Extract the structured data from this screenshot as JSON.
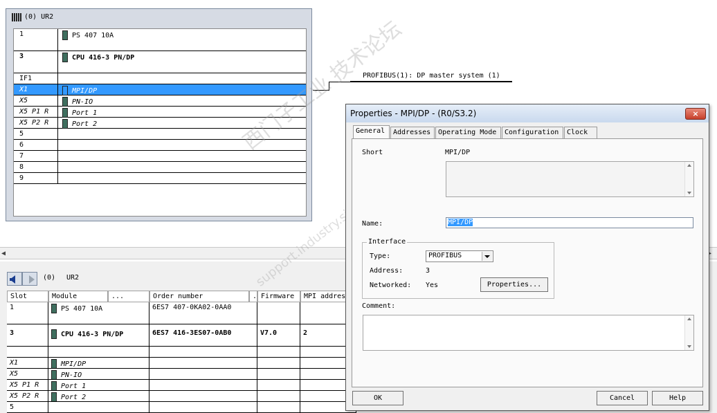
{
  "rack": {
    "title": "(0)  UR2",
    "rows": [
      {
        "slot": "1",
        "module": "PS 407 10A",
        "style": "normal",
        "icon": true
      },
      {
        "slot": "3",
        "module": "CPU 416-3 PN/DP",
        "style": "bold",
        "icon": true
      },
      {
        "slot": "IF1",
        "module": "",
        "style": "normal",
        "icon": false
      },
      {
        "slot": "X1",
        "module": "MPI/DP",
        "style": "italic",
        "icon": true,
        "selected": true
      },
      {
        "slot": "X5",
        "module": "PN-IO",
        "style": "italic",
        "icon": true
      },
      {
        "slot": "X5 P1 R",
        "module": "Port 1",
        "style": "italic",
        "icon": true
      },
      {
        "slot": "X5 P2 R",
        "module": "Port 2",
        "style": "italic",
        "icon": true
      },
      {
        "slot": "5",
        "module": "",
        "style": "normal",
        "icon": false
      },
      {
        "slot": "6",
        "module": "",
        "style": "normal",
        "icon": false
      },
      {
        "slot": "7",
        "module": "",
        "style": "normal",
        "icon": false
      },
      {
        "slot": "8",
        "module": "",
        "style": "normal",
        "icon": false
      },
      {
        "slot": "9",
        "module": "",
        "style": "normal",
        "icon": false
      }
    ]
  },
  "profibus_label": "PROFIBUS(1): DP master system (1)",
  "bottom": {
    "station": "(0)",
    "rack": "UR2",
    "headers": [
      "Slot",
      "Module",
      "...",
      "Order number",
      "...",
      "Firmware",
      "MPI addres"
    ],
    "rows": [
      {
        "slot": "1",
        "module": "PS 407 10A",
        "order": "6ES7 407-0KA02-0AA0",
        "firmware": "",
        "mpi": "",
        "style": "normal"
      },
      {
        "slot": "3",
        "module": "CPU 416-3 PN/DP",
        "order": "6ES7 416-3ES07-0AB0",
        "firmware": "V7.0",
        "mpi": "2",
        "style": "bold"
      },
      {
        "slot": "IF1",
        "module": "",
        "order": "",
        "firmware": "",
        "mpi": "",
        "style": "normal"
      },
      {
        "slot": "X1",
        "module": "MPI/DP",
        "order": "",
        "firmware": "",
        "mpi": "",
        "style": "italic"
      },
      {
        "slot": "X5",
        "module": "PN-IO",
        "order": "",
        "firmware": "",
        "mpi": "",
        "style": "italic"
      },
      {
        "slot": "X5 P1 R",
        "module": "Port 1",
        "order": "",
        "firmware": "",
        "mpi": "",
        "style": "italic"
      },
      {
        "slot": "X5 P2 R",
        "module": "Port 2",
        "order": "",
        "firmware": "",
        "mpi": "",
        "style": "italic"
      },
      {
        "slot": "5",
        "module": "",
        "order": "",
        "firmware": "",
        "mpi": "",
        "style": "normal"
      }
    ]
  },
  "dialog": {
    "title": "Properties - MPI/DP - (R0/S3.2)",
    "close": "×",
    "tabs": [
      "General",
      "Addresses",
      "Operating Mode",
      "Configuration",
      "Clock"
    ],
    "short_label": "Short",
    "short_value": "MPI/DP",
    "name_label": "Name:",
    "name_value": "MPI/DP",
    "interface_legend": "Interface",
    "type_label": "Type:",
    "type_value": "PROFIBUS",
    "address_label": "Address:",
    "address_value": "3",
    "networked_label": "Networked:",
    "networked_value": "Yes",
    "properties_btn": "Properties...",
    "comment_label": "Comment:",
    "ok": "OK",
    "cancel": "Cancel",
    "help": "Help"
  },
  "watermark": {
    "cn": "西门子工业 技术论坛",
    "url": "support.industry.siemens.com/cs"
  }
}
